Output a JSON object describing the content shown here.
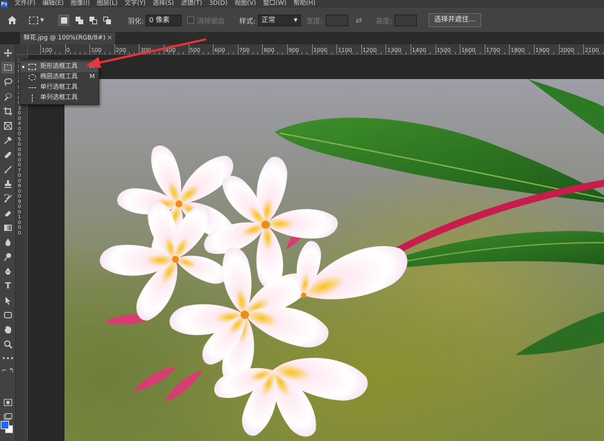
{
  "app": {
    "logo": "Ps"
  },
  "menu": [
    "文件(F)",
    "编辑(E)",
    "图像(I)",
    "图层(L)",
    "文字(Y)",
    "选择(S)",
    "滤镜(T)",
    "3D(D)",
    "视图(V)",
    "窗口(W)",
    "帮助(H)"
  ],
  "options": {
    "feather_label": "羽化:",
    "feather_value": "0 像素",
    "antialias_label": "消除锯齿",
    "style_label": "样式:",
    "style_value": "正常",
    "width_label": "宽度:",
    "height_label": "高度:",
    "select_mask_button": "选择并遮住..."
  },
  "tab": {
    "title": "鲜花.jpg @ 100%(RGB/8#)",
    "close": "×"
  },
  "ruler_top": [
    "100",
    "0",
    "100",
    "200",
    "300",
    "400",
    "500",
    "600",
    "700",
    "800",
    "900",
    "1000",
    "1100",
    "1200",
    "1300",
    "1400",
    "1500",
    "1600",
    "1700",
    "1800",
    "1900",
    "2000",
    "2100"
  ],
  "ruler_left": [
    "1",
    "0",
    "0",
    "1",
    "0",
    "0",
    "2",
    "0",
    "0",
    "3",
    "0",
    "0",
    "4",
    "0",
    "0",
    "5",
    "0",
    "0",
    "6",
    "0",
    "0",
    "7",
    "0",
    "0",
    "8",
    "0",
    "0",
    "9",
    "0",
    "0",
    "1",
    "0",
    "0",
    "0"
  ],
  "flyout": [
    {
      "label": "矩形选框工具",
      "key": "M",
      "icon": "rect-marquee-icon"
    },
    {
      "label": "椭圆选框工具",
      "key": "M",
      "icon": "ellipse-marquee-icon"
    },
    {
      "label": "单行选框工具",
      "key": "",
      "icon": "single-row-marquee-icon"
    },
    {
      "label": "单列选框工具",
      "key": "",
      "icon": "single-column-marquee-icon"
    }
  ],
  "colors": {
    "foreground": "#1e68ff",
    "background": "#ffffff",
    "annotation_arrow": "#e8343a"
  },
  "tools": [
    "move-icon",
    "marquee-icon",
    "lasso-icon",
    "quick-select-icon",
    "crop-icon",
    "frame-icon",
    "eyedropper-icon",
    "healing-icon",
    "brush-icon",
    "stamp-icon",
    "history-brush-icon",
    "eraser-icon",
    "gradient-icon",
    "blur-icon",
    "dodge-icon",
    "pen-icon",
    "type-icon",
    "path-select-icon",
    "shape-icon",
    "hand-icon",
    "zoom-icon",
    "more-icon"
  ]
}
